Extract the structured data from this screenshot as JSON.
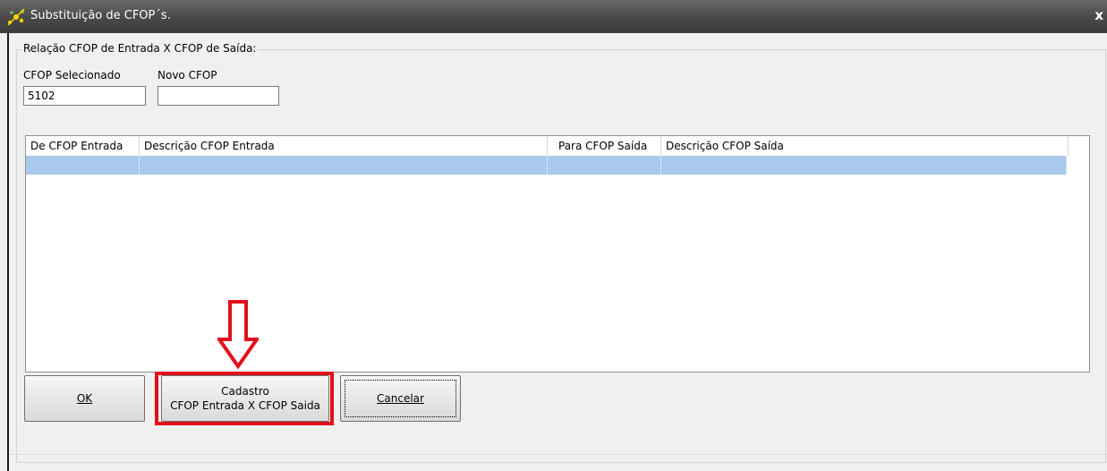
{
  "window": {
    "title": "Substituição de CFOP´s.",
    "close_glyph": "x"
  },
  "group": {
    "label": "Relação CFOP de Entrada X CFOP de Saída:"
  },
  "fields": {
    "cfop_selecionado_label": "CFOP Selecionado",
    "cfop_selecionado_value": "5102",
    "novo_cfop_label": "Novo CFOP",
    "novo_cfop_value": ""
  },
  "table": {
    "columns": [
      "De CFOP Entrada",
      "Descrição CFOP Entrada",
      "Para CFOP Saída",
      "Descrição CFOP Saída"
    ],
    "rows": [
      [
        "",
        "",
        "",
        ""
      ]
    ]
  },
  "buttons": {
    "ok": "OK",
    "cadastro_line1": "Cadastro",
    "cadastro_line2": "CFOP Entrada X CFOP Saida",
    "cancelar": "Cancelar"
  },
  "colors": {
    "annotation": "#e0101a",
    "selected_row": "#a8c8ec"
  },
  "icons": {
    "app": "app-logo-icon",
    "close": "close-icon",
    "annotation": "down-arrow-annotation-icon"
  }
}
